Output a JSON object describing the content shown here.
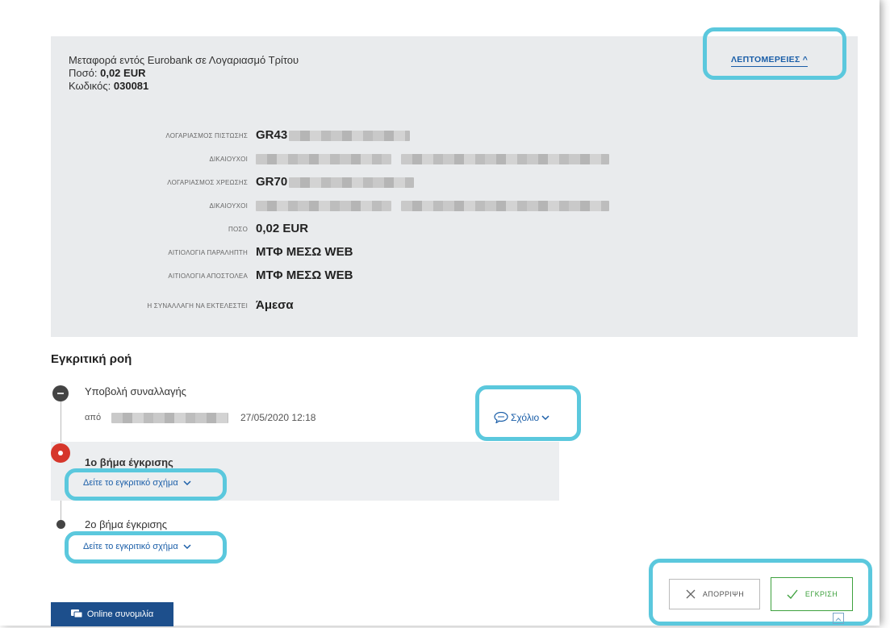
{
  "summary": {
    "title": "Μεταφορά εντός Eurobank σε Λογαριασμό Τρίτου",
    "amount_label": "Ποσό:",
    "amount_value": "0,02 EUR",
    "code_label": "Κωδικός:",
    "code_value": "030081",
    "details_button": "ΛΕΠΤΟΜΕΡΕΙΕΣ ^"
  },
  "details": [
    {
      "label": "ΛΟΓΑΡΙΑΣΜΟΣ ΠΙΣΤΩΣΗΣ",
      "value": "GR43",
      "redacted": true
    },
    {
      "label": "ΔΙΚΑΙΟΥΧΟΙ",
      "value": "",
      "redacted": true
    },
    {
      "label": "ΛΟΓΑΡΙΑΣΜΟΣ ΧΡΕΩΣΗΣ",
      "value": "GR70",
      "redacted": true
    },
    {
      "label": "ΔΙΚΑΙΟΥΧΟΙ",
      "value": "",
      "redacted": true
    },
    {
      "label": "ΠΟΣΟ",
      "value": "0,02 EUR",
      "redacted": false
    },
    {
      "label": "ΑΙΤΙΟΛΟΓΙΑ ΠΑΡΑΛΗΠΤΗ",
      "value": "ΜΤΦ ΜΕΣΩ WEB",
      "redacted": false
    },
    {
      "label": "ΑΙΤΙΟΛΟΓΙΑ ΑΠΟΣΤΟΛΕΑ",
      "value": "ΜΤΦ ΜΕΣΩ WEB",
      "redacted": false
    },
    {
      "label": "Η ΣΥΝΑΛΛΑΓΗ ΝΑ ΕΚΤΕΛΕΣΤΕΙ",
      "value": "Άμεσα",
      "redacted": false
    }
  ],
  "flow": {
    "title": "Εγκριτική ροή",
    "submit": {
      "title": "Υποβολή συναλλαγής",
      "by_label": "από",
      "datetime": "27/05/2020 12:18",
      "comment_label": "Σχόλιο"
    },
    "step1": {
      "title": "1ο βήμα έγκρισης",
      "link": "Δείτε το εγκριτικό σχήμα"
    },
    "step2": {
      "title": "2ο βήμα έγκρισης",
      "link": "Δείτε το εγκριτικό σχήμα"
    }
  },
  "actions": {
    "reject": "ΑΠΟΡΡΙΨΗ",
    "approve": "ΕΓΚΡΙΣΗ"
  },
  "chat_button": "Online συνομιλία",
  "colors": {
    "highlight": "#5bc8dd",
    "accent": "#1a5ea8",
    "approve": "#3ea13e",
    "active_step": "#d6362b",
    "chat": "#1d4f8c"
  }
}
